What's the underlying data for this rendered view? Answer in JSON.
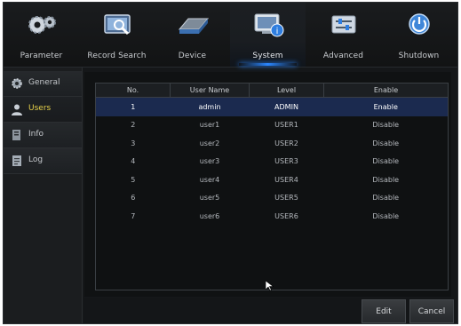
{
  "toolbar": {
    "items": [
      {
        "label": "Parameter",
        "icon": "gears-icon"
      },
      {
        "label": "Record Search",
        "icon": "record-search-icon"
      },
      {
        "label": "Device",
        "icon": "hard-drive-icon"
      },
      {
        "label": "System",
        "icon": "system-info-icon",
        "active": true
      },
      {
        "label": "Advanced",
        "icon": "advanced-settings-icon"
      },
      {
        "label": "Shutdown",
        "icon": "power-icon"
      }
    ]
  },
  "sidebar": {
    "items": [
      {
        "label": "General",
        "icon": "gear-icon"
      },
      {
        "label": "Users",
        "icon": "user-icon",
        "active": true
      },
      {
        "label": "Info",
        "icon": "info-icon"
      },
      {
        "label": "Log",
        "icon": "log-icon"
      }
    ]
  },
  "users_table": {
    "headers": {
      "no": "No.",
      "user_name": "User Name",
      "level": "Level",
      "enable": "Enable"
    },
    "rows": [
      {
        "no": "1",
        "user_name": "admin",
        "level": "ADMIN",
        "enable": "Enable"
      },
      {
        "no": "2",
        "user_name": "user1",
        "level": "USER1",
        "enable": "Disable"
      },
      {
        "no": "3",
        "user_name": "user2",
        "level": "USER2",
        "enable": "Disable"
      },
      {
        "no": "4",
        "user_name": "user3",
        "level": "USER3",
        "enable": "Disable"
      },
      {
        "no": "5",
        "user_name": "user4",
        "level": "USER4",
        "enable": "Disable"
      },
      {
        "no": "6",
        "user_name": "user5",
        "level": "USER5",
        "enable": "Disable"
      },
      {
        "no": "7",
        "user_name": "user6",
        "level": "USER6",
        "enable": "Disable"
      }
    ]
  },
  "buttons": {
    "edit": "Edit",
    "cancel": "Cancel"
  },
  "colors": {
    "accent": "#2a86ff",
    "selected_row": "#1b2a4f",
    "active_sidebar_text": "#e7d24a"
  }
}
